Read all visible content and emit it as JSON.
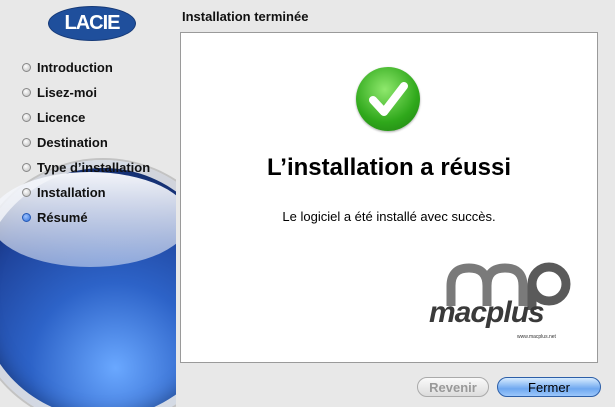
{
  "logo_text": "LACIE",
  "header": {
    "title": "Installation terminée"
  },
  "steps": [
    {
      "label": "Introduction",
      "active": false
    },
    {
      "label": "Lisez-moi",
      "active": false
    },
    {
      "label": "Licence",
      "active": false
    },
    {
      "label": "Destination",
      "active": false
    },
    {
      "label": "Type d’installation",
      "active": false
    },
    {
      "label": "Installation",
      "active": false
    },
    {
      "label": "Résumé",
      "active": true
    }
  ],
  "main": {
    "heading": "L’installation a réussi",
    "message": "Le logiciel a été installé avec succès.",
    "status_icon": "checkmark-circle-icon",
    "watermark": {
      "brand": "macplus",
      "url": "www.macplus.net"
    }
  },
  "buttons": {
    "back": "Revenir",
    "close": "Fermer"
  },
  "colors": {
    "check_green": "#2fa81b",
    "orb_blue": "#2d63c8",
    "default_button": "#6fa8f0"
  }
}
